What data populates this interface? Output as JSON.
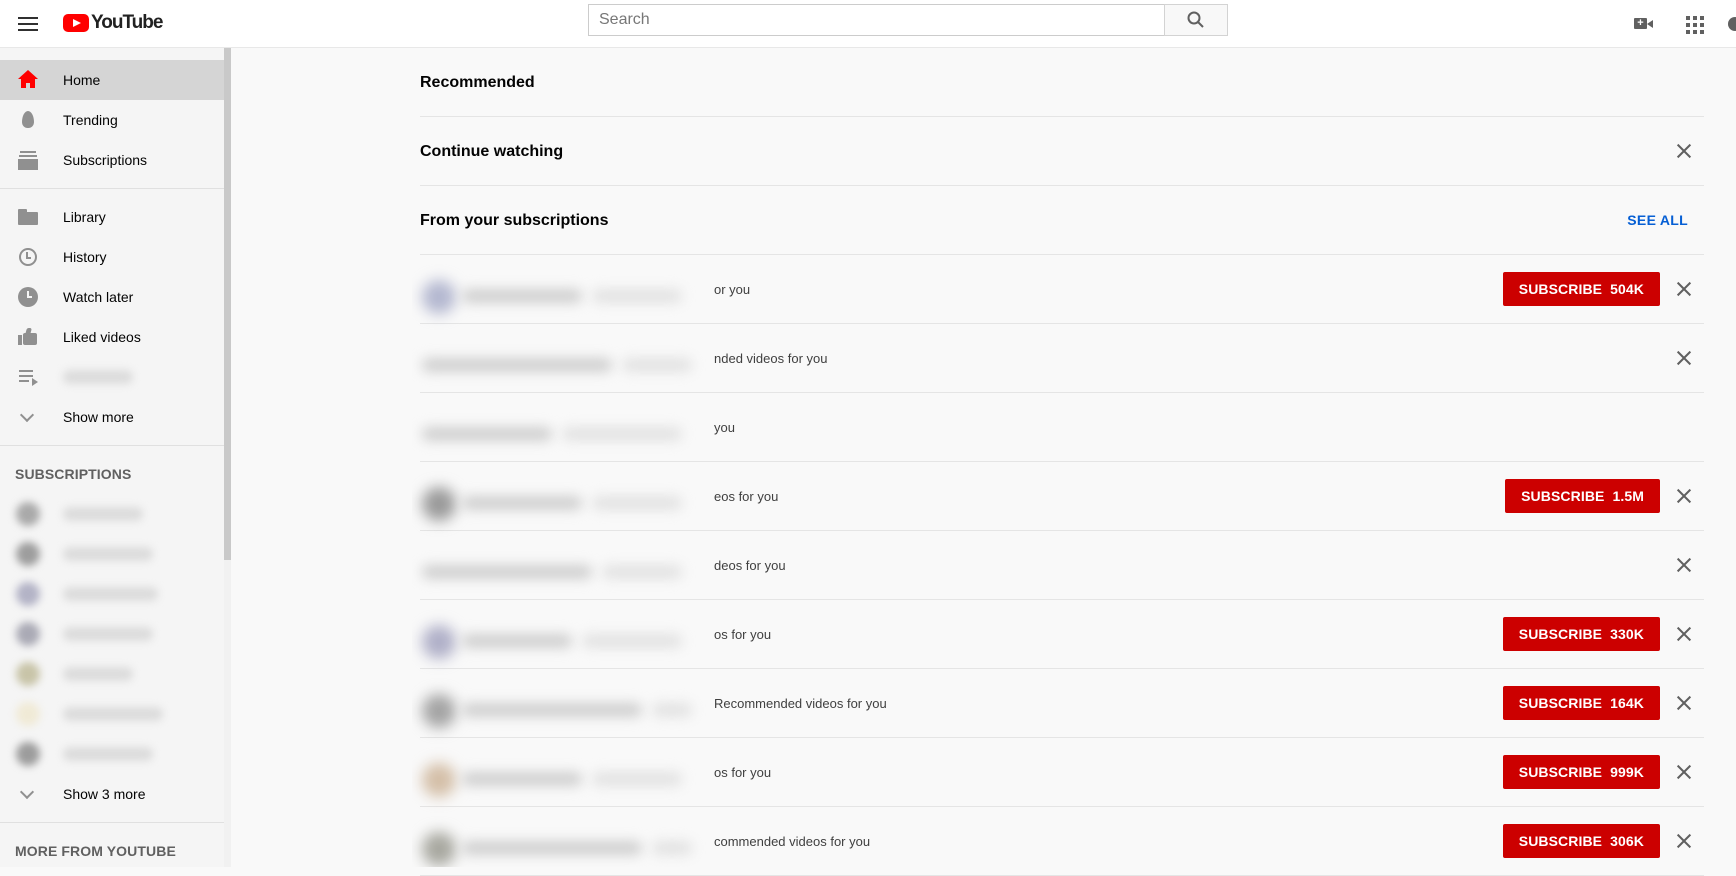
{
  "header": {
    "brand": "YouTube",
    "search_placeholder": "Search",
    "colors": {
      "brand_red": "#ff0000",
      "subscribe_red": "#cc0000",
      "link_blue": "#065fd4"
    },
    "icons": [
      "menu-icon",
      "youtube-logo-icon",
      "search-icon",
      "create-video-icon",
      "apps-grid-icon",
      "messages-icon"
    ]
  },
  "sidebar": {
    "primary": [
      {
        "label": "Home",
        "icon": "home-icon",
        "active": true
      },
      {
        "label": "Trending",
        "icon": "flame-icon"
      },
      {
        "label": "Subscriptions",
        "icon": "subscriptions-icon"
      }
    ],
    "library": [
      {
        "label": "Library",
        "icon": "folder-icon"
      },
      {
        "label": "History",
        "icon": "history-icon"
      },
      {
        "label": "Watch later",
        "icon": "clock-icon"
      },
      {
        "label": "Liked videos",
        "icon": "thumbs-up-icon"
      }
    ],
    "show_more": "Show more",
    "subscriptions_heading": "SUBSCRIPTIONS",
    "show_3_more": "Show 3 more",
    "more_heading": "MORE FROM YOUTUBE"
  },
  "main": {
    "sections": {
      "recommended": "Recommended",
      "continue_watching": "Continue watching",
      "from_subscriptions": "From your subscriptions",
      "see_all": "SEE ALL"
    },
    "subscribe_label": "SUBSCRIBE",
    "channel_rows": [
      {
        "text": "or you",
        "subscribers": "504K",
        "show_subscribe": true,
        "show_close": true
      },
      {
        "text": "nded videos for you",
        "subscribers": "",
        "show_subscribe": false,
        "show_close": true
      },
      {
        "text": "you",
        "subscribers": "",
        "show_subscribe": false,
        "show_close": false
      },
      {
        "text": "eos for you",
        "subscribers": "1.5M",
        "show_subscribe": true,
        "show_close": true
      },
      {
        "text": "deos for you",
        "subscribers": "",
        "show_subscribe": false,
        "show_close": true
      },
      {
        "text": "os for you",
        "subscribers": "330K",
        "show_subscribe": true,
        "show_close": true
      },
      {
        "text": "Recommended videos for you",
        "subscribers": "164K",
        "show_subscribe": true,
        "show_close": true
      },
      {
        "text": "os for you",
        "subscribers": "999K",
        "show_subscribe": true,
        "show_close": true
      },
      {
        "text": "commended videos for you",
        "subscribers": "306K",
        "show_subscribe": true,
        "show_close": true
      }
    ]
  }
}
